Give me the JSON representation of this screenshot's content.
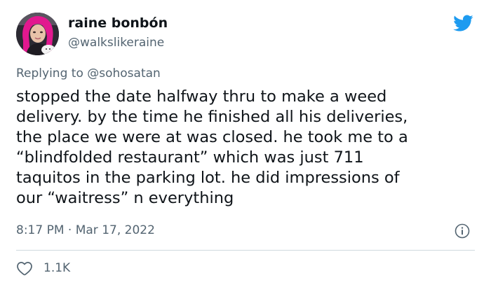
{
  "author": {
    "name": "raine bonbón",
    "handle": "@walkslikeraine"
  },
  "reply": {
    "prefix": "Replying to",
    "mention": "@sohosatan"
  },
  "tweet": {
    "lines": [
      "stopped the date halfway thru to make a weed",
      "delivery. by the time he finished all his deliveries,",
      "the place we were at was closed. he took me to a",
      "“blindfolded restaurant” which was just 711",
      "taquitos in the parking lot. he did impressions of",
      "our “waitress” n everything"
    ]
  },
  "meta": {
    "timestamp": "8:17 PM · Mar 17, 2022"
  },
  "engagement": {
    "likes": "1.1K"
  },
  "icons": {
    "brand": "twitter-bird-icon",
    "info": "info-icon",
    "like": "heart-icon"
  },
  "colors": {
    "brand_blue": "#1d9bf0",
    "text": "#0f1419",
    "secondary": "#536471",
    "divider": "#cfd9de",
    "avatar_hair": "#e2188f"
  }
}
